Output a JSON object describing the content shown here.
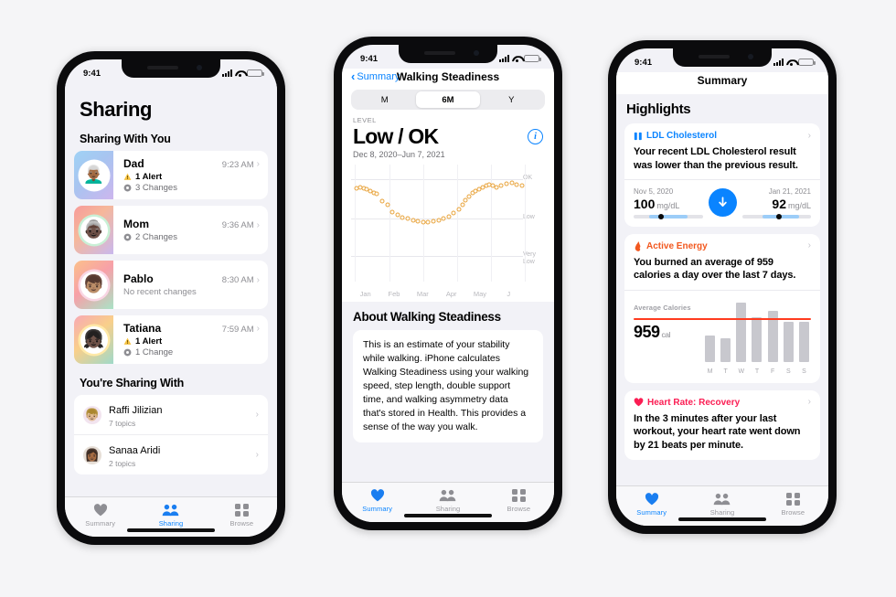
{
  "status_bar": {
    "time": "9:41"
  },
  "phone1": {
    "title": "Sharing",
    "section1_title": "Sharing With You",
    "people": [
      {
        "name": "Dad",
        "time": "9:23 AM",
        "alert": "1 Alert",
        "changes": "3 Changes",
        "avatar": "👨🏾‍🦳",
        "chevron": "›"
      },
      {
        "name": "Mom",
        "time": "9:36 AM",
        "alert": "",
        "changes": "2 Changes",
        "avatar": "👵🏿",
        "chevron": "›"
      },
      {
        "name": "Pablo",
        "time": "8:30 AM",
        "alert": "",
        "changes": "",
        "none": "No recent changes",
        "avatar": "👦🏽",
        "chevron": "›"
      },
      {
        "name": "Tatiana",
        "time": "7:59 AM",
        "alert": "1 Alert",
        "changes": "1 Change",
        "avatar": "👧🏿",
        "chevron": "›"
      }
    ],
    "section2_title": "You're Sharing With",
    "topics": [
      {
        "name": "Raffi Jilizian",
        "sub": "7 topics",
        "avatar": "👦🏼",
        "chevron": "›"
      },
      {
        "name": "Sanaa Aridi",
        "sub": "2 topics",
        "avatar": "👩🏾",
        "chevron": "›"
      }
    ],
    "tabs": [
      {
        "label": "Summary",
        "icon": "heart-icon",
        "active": false
      },
      {
        "label": "Sharing",
        "icon": "people-icon",
        "active": true
      },
      {
        "label": "Browse",
        "icon": "grid-icon",
        "active": false
      }
    ]
  },
  "phone2": {
    "back_label": "Summary",
    "nav_title": "Walking Steadiness",
    "segments": [
      {
        "label": "M",
        "selected": false
      },
      {
        "label": "6M",
        "selected": true
      },
      {
        "label": "Y",
        "selected": false
      }
    ],
    "level_label": "LEVEL",
    "level_value": "Low / OK",
    "date_range": "Dec 8, 2020–Jun 7, 2021",
    "info_icon": "info-icon",
    "about_title": "About Walking Steadiness",
    "about_text": "This is an estimate of your stability while walking. iPhone calculates Walking Steadiness using your walking speed, step length, double support time, and walking asymmetry data that's stored in Health. This provides a sense of the way you walk.",
    "tabs": [
      {
        "label": "Summary",
        "icon": "heart-icon",
        "active": true
      },
      {
        "label": "Sharing",
        "icon": "people-icon",
        "active": false
      },
      {
        "label": "Browse",
        "icon": "grid-icon",
        "active": false
      }
    ]
  },
  "phone3": {
    "nav_title": "Summary",
    "highlights_title": "Highlights",
    "cards": [
      {
        "icon": "ldl-bars-icon",
        "title": "LDL Cholesterol",
        "title_color": "#0a84ff",
        "description": "Your recent LDL Cholesterol result was lower than the previous result.",
        "chevron": "›",
        "left": {
          "date": "Nov 5, 2020",
          "value": "100",
          "unit": "mg/dL",
          "marker_pct": 40,
          "fill_start_pct": 22,
          "fill_end_pct": 78
        },
        "right": {
          "date": "Jan 21, 2021",
          "value": "92",
          "unit": "mg/dL",
          "marker_pct": 53,
          "fill_start_pct": 30,
          "fill_end_pct": 83
        },
        "arrow": "down-arrow-icon"
      },
      {
        "icon": "flame-icon",
        "title": "Active Energy",
        "title_color": "#f2581f",
        "description": "You burned an average of 959 calories a day over the last 7 days.",
        "chevron": "›",
        "caption": "Average Calories",
        "value": "959",
        "unit": "cal"
      },
      {
        "icon": "heart-filled-icon",
        "title": "Heart Rate: Recovery",
        "title_color": "#fb1d53",
        "description": "In the 3 minutes after your last workout, your heart rate went down by 21 beats per minute.",
        "chevron": "›"
      }
    ],
    "tabs": [
      {
        "label": "Summary",
        "icon": "heart-icon",
        "active": true
      },
      {
        "label": "Sharing",
        "icon": "people-icon",
        "active": false
      },
      {
        "label": "Browse",
        "icon": "grid-icon",
        "active": false
      }
    ]
  },
  "chart_data": [
    {
      "type": "scatter",
      "title": "Walking Steadiness",
      "subtitle": "Low / OK",
      "xlabel": "",
      "ylabel": "",
      "date_range": "Dec 8, 2020–Jun 7, 2021",
      "x_tick_labels": [
        "Jan",
        "Feb",
        "Mar",
        "Apr",
        "May",
        "J"
      ],
      "y_tick_labels": [
        "OK",
        "Low",
        "Very Low"
      ],
      "y_tick_pct": [
        12,
        46,
        78
      ],
      "grid": true,
      "legend": "none",
      "series": [
        {
          "name": "Walking Steadiness",
          "color": "#e8a33d",
          "x": [
            1,
            3,
            5,
            7,
            9,
            11,
            13,
            16,
            19,
            22,
            25,
            28,
            31,
            34,
            37,
            40,
            43,
            46,
            49,
            52,
            55,
            58,
            61,
            63,
            65,
            67,
            69,
            71,
            73,
            75,
            77,
            79,
            81,
            83,
            86,
            89,
            92,
            95,
            98
          ],
          "y": [
            20,
            19,
            20,
            21,
            22,
            24,
            25,
            31,
            34,
            40,
            43,
            45,
            46,
            47,
            48,
            49,
            49,
            48,
            47,
            46,
            44,
            41,
            38,
            34,
            30,
            27,
            24,
            22,
            21,
            19,
            18,
            17,
            18,
            19,
            18,
            16,
            15,
            17,
            18
          ]
        }
      ],
      "ylim_note": "0 = top (OK) .. 100 = bottom (Very Low)"
    },
    {
      "type": "bar",
      "title": "Average Calories",
      "categories": [
        "M",
        "T",
        "W",
        "T",
        "F",
        "S",
        "S"
      ],
      "values": [
        580,
        500,
        1290,
        980,
        1120,
        870,
        870
      ],
      "average": 959,
      "average_label": "Average Calories",
      "unit": "cal",
      "bar_color": "#c8c8ce",
      "average_line_color": "#ff3b1f",
      "ylim": [
        0,
        1400
      ]
    }
  ]
}
